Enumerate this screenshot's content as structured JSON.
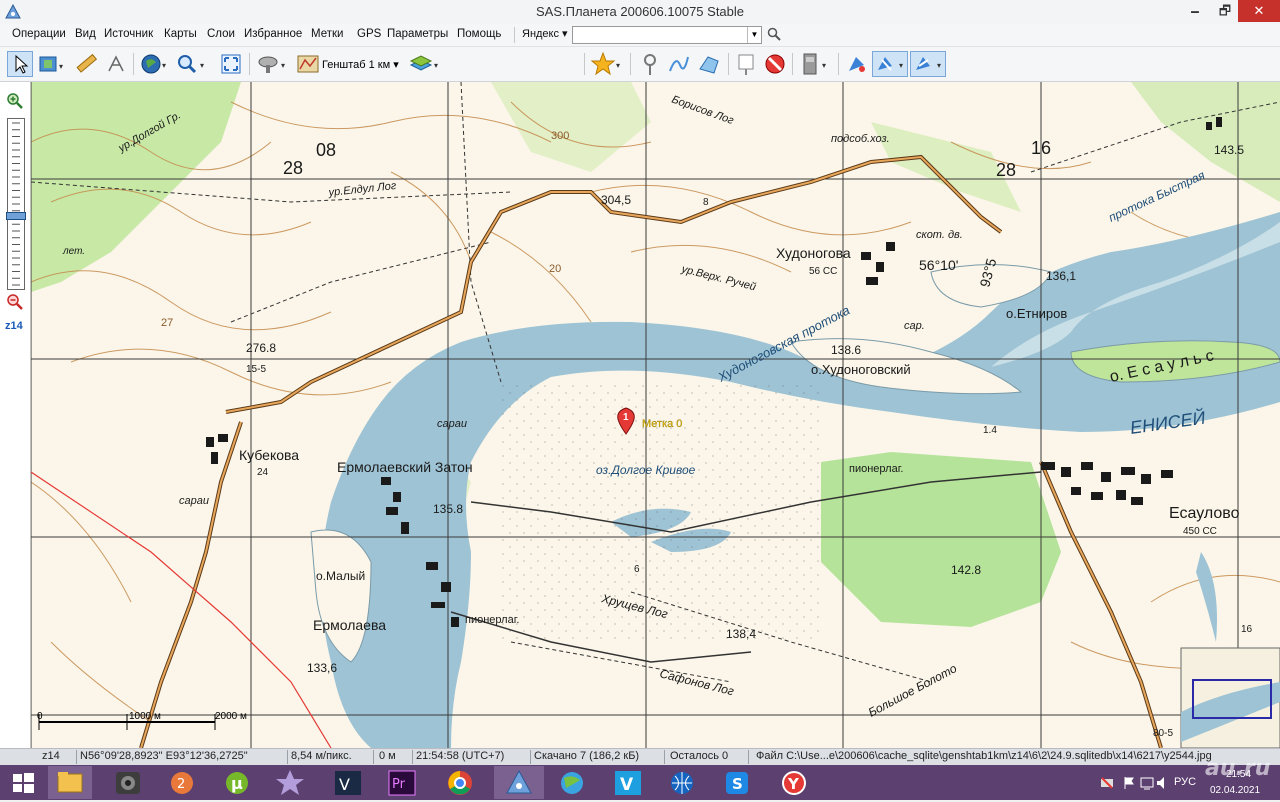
{
  "window": {
    "title": "SAS.Планета 200606.10075 Stable",
    "minimize": "🗕",
    "maximize": "🗗",
    "close": "✕"
  },
  "menu": {
    "items": [
      "Операции",
      "Вид",
      "Источник",
      "Карты",
      "Слои",
      "Избранное",
      "Метки",
      "GPS",
      "Параметры",
      "Помощь"
    ],
    "search_engine": "Яндекс ▾",
    "search_value": ""
  },
  "toolbar": {
    "map_layer": "Генштаб 1 км ▾"
  },
  "zoom": {
    "level_label": "z14",
    "level": 14,
    "max": 24
  },
  "map": {
    "labels": {
      "khudonogova": "Худоногова",
      "khudonogova_pop": "56 СС",
      "kubekova": "Кубекова",
      "kubekova_pop": "24",
      "ermolaevsky_zaton": "Ермолаевский Затон",
      "ermolaeva": "Ермолаева",
      "esaulovo": "Есаулово",
      "esaulovo_pop": "450 СС",
      "enisei": "ЕНИСЕЙ",
      "o_esauls": "о. Е с а у л ь с",
      "o_khudonogovsky": "о.Худоноговский",
      "o_etnirov": "о.Етниров",
      "khud_protoka": "Худоноговская протока",
      "protoka_bystraya": "протока Быстрая",
      "o_maly": "о.Малый",
      "pionerlag1": "пионерлаг.",
      "pionerlag2": "пионерлаг.",
      "podsob_hoz": "подсоб.хоз.",
      "skot_dv": "скот. дв.",
      "ur_edgul_log": "ур.Елдул Лог",
      "ur_dolgoy_gr": "ур.Долгой Гр.",
      "ur_verkh_ruchey": "ур.Верх. Ручей",
      "borisov_log": "Борисов Лог",
      "oz_dolgoe_krivoe": "оз.Долгое Кривое",
      "khrushev_log": "Хрущев Лог",
      "safonov_log": "Сафонов Лог",
      "bolshoe_boloto": "Большое Болото",
      "elev_2768": "276.8",
      "elev_3045": "304,5",
      "elev_1386": "138.6",
      "elev_1361": "136,1",
      "elev_1358": "135.8",
      "elev_1428": "142.8",
      "elev_1384": "138,4",
      "elev_1336": "133,6",
      "elev_1435": "143.5",
      "grid_28a": "28",
      "grid_08": "08",
      "grid_28b": "28",
      "grid_16": "16",
      "grid_5610": "56°10'",
      "grid_935": "93°5",
      "lat": "лет.",
      "sarai1": "сараи",
      "sarai2": "сараи",
      "sarai3": "сар.",
      "num_8": "8",
      "num_6": "6",
      "num_27": "27",
      "num_20": "20",
      "num_300": "300",
      "num_16": "16",
      "road_15_5": "15-5",
      "road_80_5": "80-5",
      "flow": "1.4",
      "marker_num": "1",
      "marker_label": "Метка 0"
    },
    "scale": [
      "0",
      "1000 м",
      "2000 м"
    ]
  },
  "status": {
    "zoom": "z14",
    "coords": "N56°09'28,8923\" E93°12'36,2725\"",
    "resolution": "8,54 м/пикс.",
    "distance": "0 м",
    "time": "21:54:58 (UTC+7)",
    "downloaded": "Скачано 7 (186,2 кБ)",
    "remaining": "Осталось 0",
    "file": "Файл C:\\Use...e\\200606\\cache_sqlite\\genshtab1km\\z14\\6\\2\\24.9.sqlitedb\\x14\\6217\\y2544.jpg"
  },
  "taskbar": {
    "lang": "РУС",
    "time": "21:54",
    "date": "02.04.2021"
  },
  "watermark": "au.ru",
  "colors": {
    "water": "#9ec3d4",
    "forest": "#bfe59a",
    "land": "#fbf6e9",
    "contour": "#c4894a",
    "road": "#b8793a",
    "taskbar": "#5c4070"
  }
}
